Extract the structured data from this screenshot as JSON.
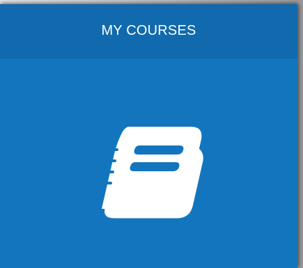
{
  "tile": {
    "title": "MY COURSES",
    "icon": "book-icon",
    "colors": {
      "header": "#106aad",
      "body": "#1375be",
      "icon": "#ffffff"
    }
  }
}
